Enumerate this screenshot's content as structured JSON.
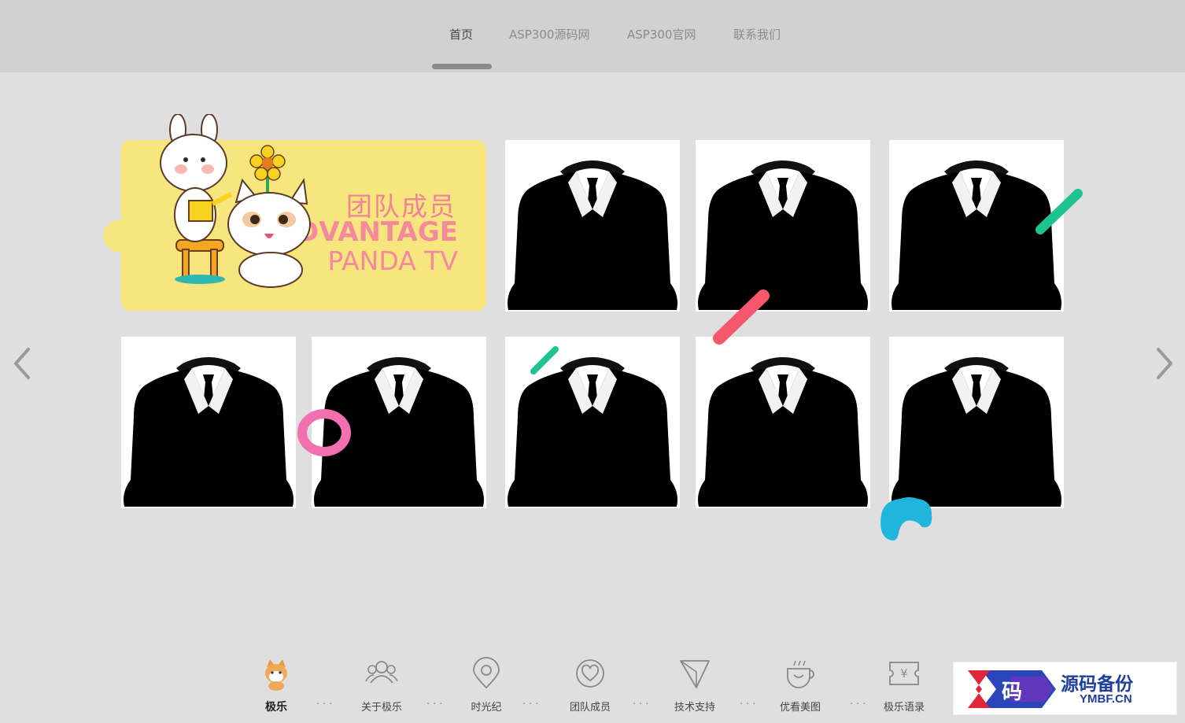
{
  "nav": {
    "items": [
      {
        "label": "首页",
        "active": true
      },
      {
        "label": "ASP300源码网",
        "active": false
      },
      {
        "label": "ASP300官网",
        "active": false
      },
      {
        "label": "联系我们",
        "active": false
      }
    ]
  },
  "banner": {
    "title_cn": "团队成员",
    "title_en": "ADVANTAGE",
    "subtitle": "PANDA TV"
  },
  "team": {
    "member_icon": "suit-silhouette-icon",
    "count": 8
  },
  "footer": {
    "items": [
      {
        "label": "极乐",
        "icon": "shiba-dog-icon",
        "active": true
      },
      {
        "label": "关于极乐",
        "icon": "people-group-icon",
        "active": false
      },
      {
        "label": "时光纪",
        "icon": "location-pin-icon",
        "active": false
      },
      {
        "label": "团队成员",
        "icon": "heart-circle-icon",
        "active": false
      },
      {
        "label": "技术支持",
        "icon": "paper-plane-icon",
        "active": false
      },
      {
        "label": "优看美图",
        "icon": "coffee-cup-icon",
        "active": false
      },
      {
        "label": "极乐语录",
        "icon": "ticket-yuan-icon",
        "active": false
      }
    ],
    "separator": "···"
  },
  "watermark": {
    "logo_char": "码",
    "text_cn": "源码备份",
    "text_en": "YMBF.CN"
  },
  "colors": {
    "header_bg": "#d1d1d1",
    "page_bg": "#dfdfdf",
    "banner_bg": "#f6e67d",
    "banner_text": "#f48a9c",
    "watermark_blue": "#1f3f9c"
  }
}
